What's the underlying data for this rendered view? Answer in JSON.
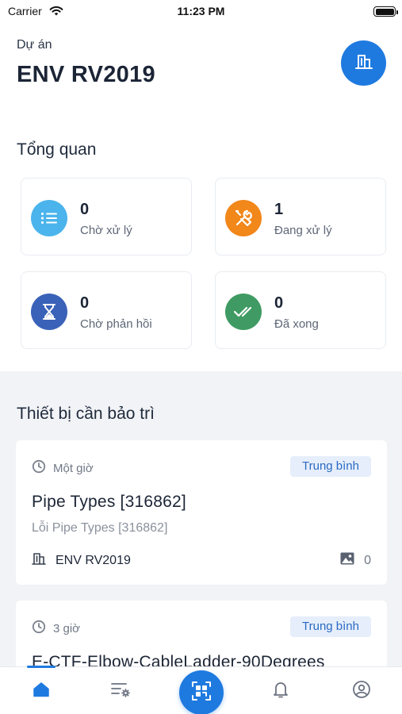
{
  "status_bar": {
    "carrier": "Carrier",
    "time": "11:23 PM",
    "battery_level": 1.0
  },
  "project": {
    "label": "Dự án",
    "name": "ENV RV2019",
    "button_icon": "building-icon"
  },
  "overview": {
    "title": "Tổng quan",
    "cards": [
      {
        "value": "0",
        "label": "Chờ xử lý",
        "icon": "list-icon",
        "color": "#4bb4ec"
      },
      {
        "value": "1",
        "label": "Đang xử lý",
        "icon": "tools-icon",
        "color": "#f2871a"
      },
      {
        "value": "0",
        "label": "Chờ phản hồi",
        "icon": "hourglass-icon",
        "color": "#3a62b8"
      },
      {
        "value": "0",
        "label": "Đã xong",
        "icon": "double-check-icon",
        "color": "#3f9b63"
      }
    ]
  },
  "maintenance": {
    "title": "Thiết bị cần bảo trì",
    "items": [
      {
        "time": "Một giờ",
        "priority": "Trung bình",
        "title": "Pipe Types [316862]",
        "subtitle": "Lỗi Pipe Types [316862]",
        "project": "ENV RV2019",
        "image_count": "0"
      },
      {
        "time": "3 giờ",
        "priority": "Trung bình",
        "title": "E-CTF-Elbow-CableLadder-90Degrees"
      }
    ]
  },
  "colors": {
    "accent": "#1f7ae0",
    "badge_bg": "#e6eefb",
    "badge_text": "#2a6bc4",
    "section_bg": "#f1f3f6"
  },
  "tab_bar": {
    "tabs": [
      "home-icon",
      "filter-settings-icon",
      "qr-scan-icon",
      "bell-icon",
      "user-profile-icon"
    ],
    "active": "home-icon"
  }
}
